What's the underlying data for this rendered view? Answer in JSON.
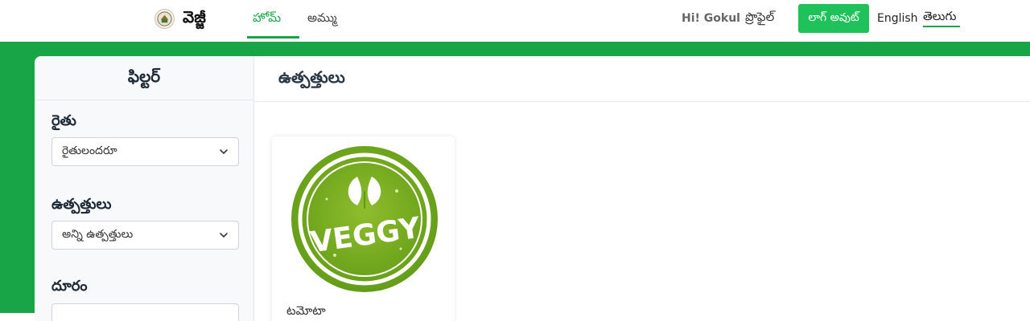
{
  "header": {
    "brand_name": "వెజ్జీ",
    "nav": {
      "home": "హోమ్",
      "sell": "అమ్ము"
    },
    "greeting": "Hi! Gokul",
    "profile": "ప్రొఫైల్",
    "logout": "లాగ్ అవుట్",
    "lang_english": "English",
    "lang_telugu": "తెలుగు"
  },
  "filter": {
    "title": "ఫిల్టర్",
    "farmer_label": "రైతు",
    "farmer_value": "రైతులందరూ",
    "product_label": "ఉత్పత్తులు",
    "product_value": "అన్ని ఉత్పత్తులు",
    "distance_label": "దూరం"
  },
  "products": {
    "title": "ఉత్పత్తులు",
    "items": [
      {
        "name": "టమోటా",
        "logo_text": "VEGGY"
      }
    ]
  },
  "colors": {
    "accent": "#18a548",
    "button": "#1fc25a"
  }
}
